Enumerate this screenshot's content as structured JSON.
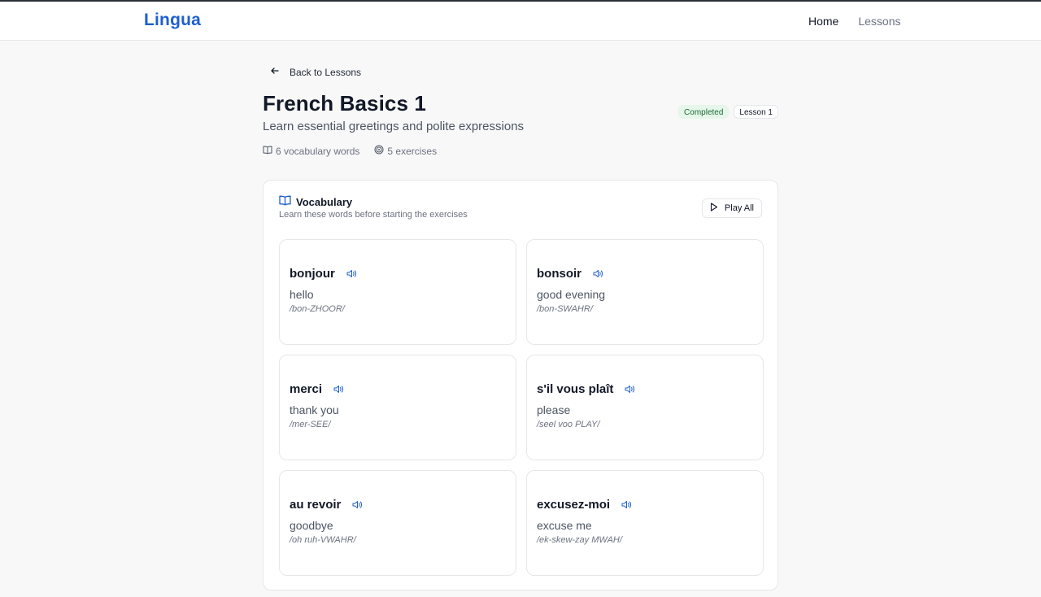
{
  "header": {
    "logo": "Lingua",
    "nav": {
      "home": "Home",
      "lessons": "Lessons"
    }
  },
  "back_link": "Back to Lessons",
  "lesson": {
    "title": "French Basics 1",
    "subtitle": "Learn essential greetings and polite expressions",
    "status_badge": "Completed",
    "lesson_badge": "Lesson 1",
    "vocab_count": "6 vocabulary words",
    "exercise_count": "5 exercises"
  },
  "vocabulary": {
    "title": "Vocabulary",
    "subtitle": "Learn these words before starting the exercises",
    "play_all": "Play All",
    "words": [
      {
        "word": "bonjour",
        "translation": "hello",
        "pronunciation": "/bon-ZHOOR/"
      },
      {
        "word": "bonsoir",
        "translation": "good evening",
        "pronunciation": "/bon-SWAHR/"
      },
      {
        "word": "merci",
        "translation": "thank you",
        "pronunciation": "/mer-SEE/"
      },
      {
        "word": "s'il vous plaît",
        "translation": "please",
        "pronunciation": "/seel voo PLAY/"
      },
      {
        "word": "au revoir",
        "translation": "goodbye",
        "pronunciation": "/oh ruh-VWAHR/"
      },
      {
        "word": "excusez-moi",
        "translation": "excuse me",
        "pronunciation": "/ek-skew-zay MWAH/"
      }
    ]
  },
  "colors": {
    "brand": "#1d5fd1",
    "completed_bg": "#e6f6ea",
    "completed_text": "#1d6b34"
  },
  "icons": {
    "back": "arrow-left-icon",
    "book": "book-open-icon",
    "target": "target-icon",
    "play": "play-icon",
    "speaker": "speaker-icon"
  }
}
